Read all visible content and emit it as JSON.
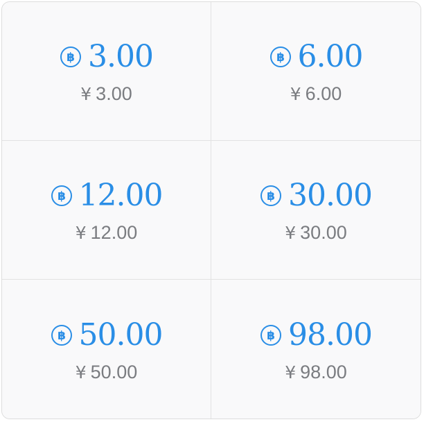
{
  "options": [
    {
      "coin": "3.00",
      "price_symbol": "¥",
      "price": "3.00"
    },
    {
      "coin": "6.00",
      "price_symbol": "¥",
      "price": "6.00"
    },
    {
      "coin": "12.00",
      "price_symbol": "¥",
      "price": "12.00"
    },
    {
      "coin": "30.00",
      "price_symbol": "¥",
      "price": "30.00"
    },
    {
      "coin": "50.00",
      "price_symbol": "¥",
      "price": "50.00"
    },
    {
      "coin": "98.00",
      "price_symbol": "¥",
      "price": "98.00"
    }
  ],
  "style": {
    "accent_color": "#2a8ee6",
    "price_color": "#7a7c80",
    "coin_icon": "bitcoin-coin-icon"
  }
}
